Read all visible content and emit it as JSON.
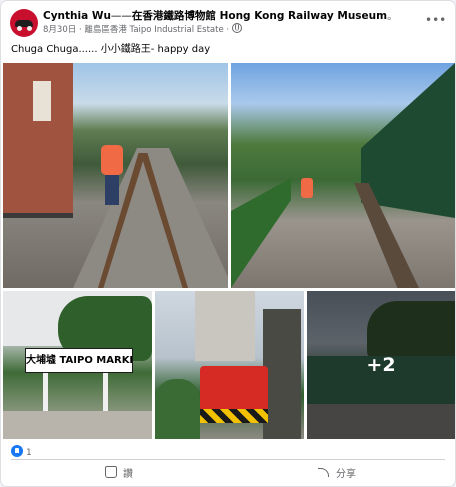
{
  "post": {
    "author": "Cynthia Wu",
    "separator": "——",
    "location_text": "在香港鐵路博物館 Hong Kong Railway Museum",
    "title_dot": "。",
    "date": "8月30日",
    "meta_dot": "·",
    "place": "離島區香港 Taipo Industrial Estate",
    "audience_dot": "·",
    "more_icon_glyph": "•••",
    "caption": "Chuga Chuga...... 小小鐵路王- happy day"
  },
  "photos": {
    "extra_count": "+2",
    "sign_text": "大埔墟 TAIPO MARKET 大埔墟"
  },
  "reactions": {
    "count": "1",
    "icon": "like-icon"
  },
  "actions": {
    "like_label": "讚",
    "share_label": "分享"
  },
  "colors": {
    "brand_blue": "#1877f2",
    "secondary_text": "#65676b",
    "divider": "#ced0d4"
  }
}
